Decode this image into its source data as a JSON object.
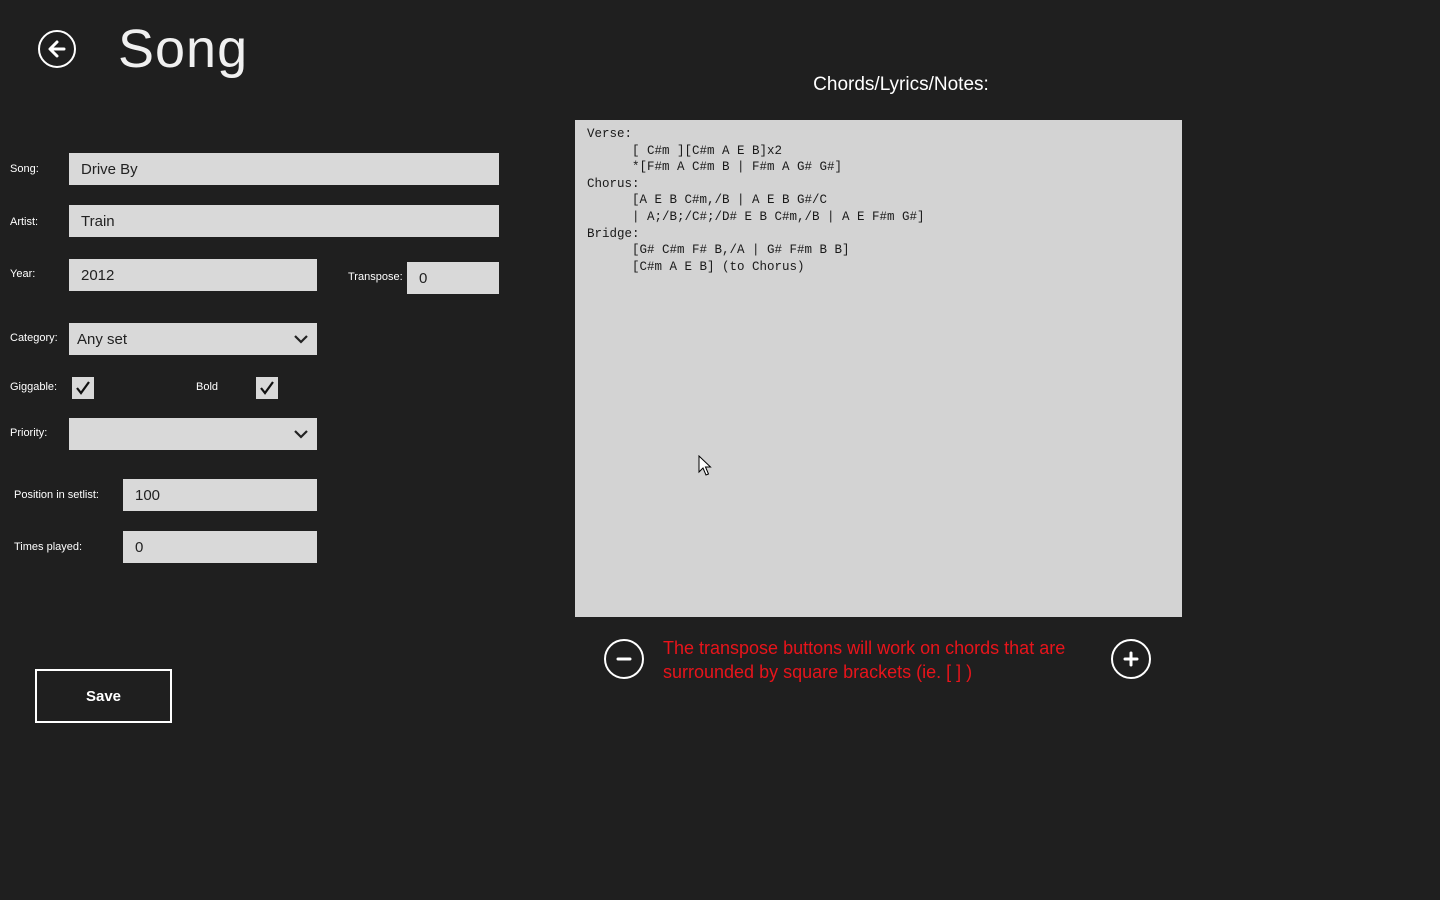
{
  "header": {
    "title": "Song",
    "back_icon": "back-arrow-icon"
  },
  "form": {
    "song_label": "Song:",
    "song_value": "Drive By",
    "artist_label": "Artist:",
    "artist_value": "Train",
    "year_label": "Year:",
    "year_value": "2012",
    "transpose_label": "Transpose:",
    "transpose_value": "0",
    "category_label": "Category:",
    "category_value": "Any set",
    "giggable_label": "Giggable:",
    "giggable_checked": true,
    "bold_label": "Bold",
    "bold_checked": true,
    "priority_label": "Priority:",
    "priority_value": "",
    "position_label": "Position in setlist:",
    "position_value": "100",
    "times_played_label": "Times played:",
    "times_played_value": "0",
    "save_label": "Save"
  },
  "notes": {
    "title": "Chords/Lyrics/Notes:",
    "content": "Verse:\n      [ C#m ][C#m A E B]x2\n      *[F#m A C#m B | F#m A G# G#]\nChorus:\n      [A E B C#m,/B | A E B G#/C\n      | A;/B;/C#;/D# E B C#m,/B | A E F#m G#]\nBridge:\n      [G# C#m F# B,/A | G# F#m B B]\n      [C#m A E B] (to Chorus)"
  },
  "transpose_controls": {
    "hint": "The transpose buttons will work on chords that are surrounded by square brackets (ie. [ ] )",
    "hint_color": "#e8141b",
    "minus_icon": "minus-circle-icon",
    "plus_icon": "plus-circle-icon"
  }
}
